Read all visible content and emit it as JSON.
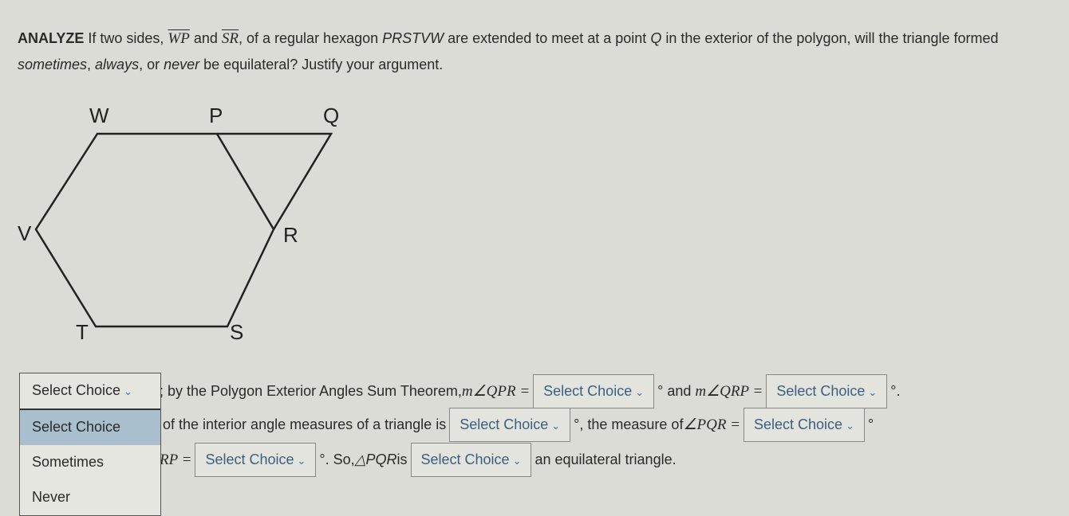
{
  "question": {
    "lead": "ANALYZE",
    "t1": " If two sides, ",
    "wp": "WP",
    "t2": " and ",
    "sr": "SR",
    "t3": ", of a regular hexagon ",
    "poly": "PRSTVW",
    "t4": " are extended to meet at a point ",
    "q": "Q",
    "t5": " in the exterior of the polygon, will the triangle formed ",
    "s": "sometimes",
    "c1": ", ",
    "a": "always",
    "c2": ", or ",
    "n": "never",
    "t6": " be equilateral? Justify your argument."
  },
  "figure": {
    "labels": {
      "W": "W",
      "P": "P",
      "Q": "Q",
      "V": "V",
      "R": "R",
      "T": "T",
      "S": "S"
    }
  },
  "answer": {
    "select": "Select Choice",
    "r1a": "; by the Polygon Exterior Angles Sum Theorem, ",
    "m1": "m∠QPR =",
    "deg": "°",
    "r1b": " and ",
    "m2": "m∠QRP =",
    "dot": "°.",
    "r2a": "of the interior angle measures of a triangle is",
    "r2b": "°, the measure of ",
    "m3": "∠PQR =",
    "r3m": "RP =",
    "r3a": "°. So, ",
    "tri": "△PQR",
    "r3b": " is",
    "r3c": "an equilateral triangle."
  },
  "dropdown": {
    "selected": "Select Choice",
    "options": [
      "Select Choice",
      "Sometimes",
      "Never"
    ]
  }
}
